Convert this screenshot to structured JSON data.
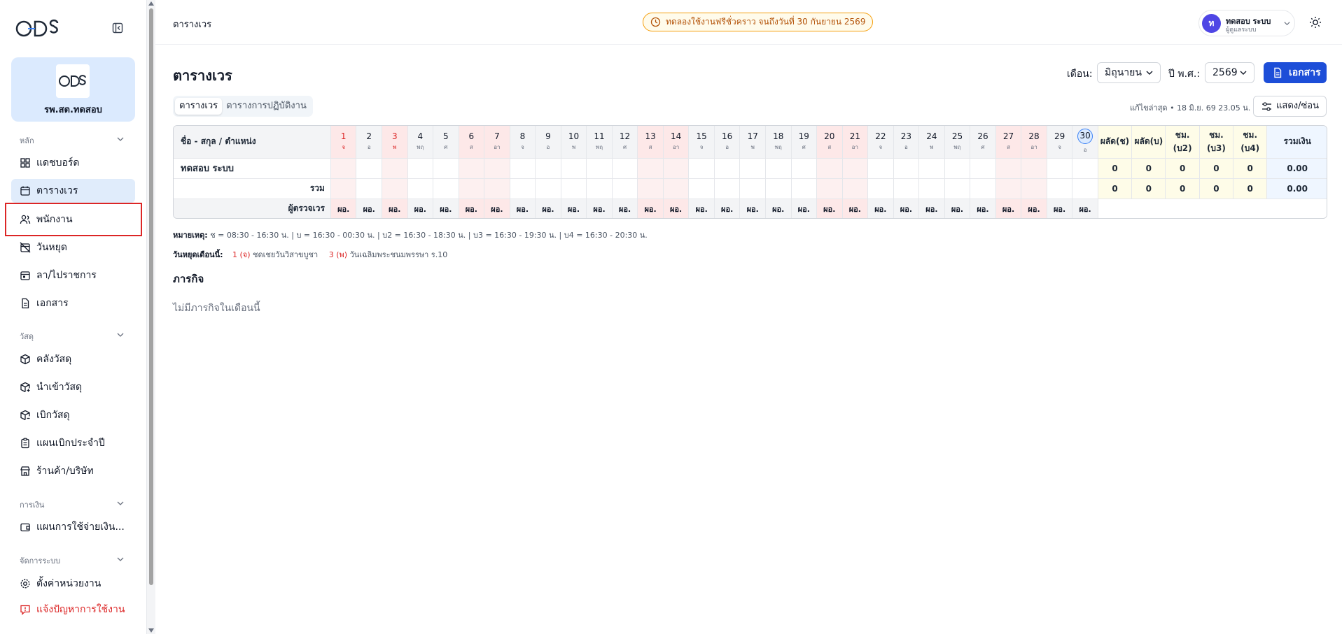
{
  "sidebar": {
    "org_name": "รพ.สต.ทดสอบ",
    "sections": [
      {
        "title": "หลัก"
      },
      {
        "title": "วัสดุ"
      },
      {
        "title": "การเงิน"
      },
      {
        "title": "จัดการระบบ"
      }
    ],
    "items": {
      "dashboard": "แดชบอร์ด",
      "schedule": "ตารางเวร",
      "staff": "พนักงาน",
      "holidays": "วันหยุด",
      "leave": "ลา/ไปราชการ",
      "documents": "เอกสาร",
      "stock": "คลังวัสดุ",
      "import": "นำเข้าวัสดุ",
      "withdraw": "เบิกวัสดุ",
      "yearly_plan": "แผนเบิกประจำปี",
      "vendors": "ร้านค้า/บริษัท",
      "budget_plan": "แผนการใช้จ่ายเงิน...",
      "unit_settings": "ตั้งค่าหน่วยงาน",
      "report_issue": "แจ้งปัญหาการใช้งาน"
    }
  },
  "topbar": {
    "breadcrumb": "ตารางเวร",
    "trial_notice": "ทดลองใช้งานฟรีชั่วคราว จนถึงวันที่ 30 กันยายน 2569",
    "user_initial": "ท",
    "user_name": "ทดสอบ ระบบ",
    "user_role": "ผู้ดูแลระบบ"
  },
  "main": {
    "title": "ตารางเวร",
    "month_label": "เดือน:",
    "month_value": "มิถุนายน",
    "year_label": "ปี พ.ศ.:",
    "year_value": "2569",
    "doc_button": "เอกสาร",
    "tabs": [
      "ตารางเวร",
      "ตารางการปฏิบัติงาน"
    ],
    "last_edit": "แก้ไขล่าสุด • 18 มิ.ย. 69 23.05 น.",
    "toggle_button": "แสดง/ซ่อน"
  },
  "table": {
    "name_header": "ชื่อ - สกุล / ตำแหน่ง",
    "days": [
      {
        "d": "1",
        "w": "จ",
        "red": true
      },
      {
        "d": "2",
        "w": "อ"
      },
      {
        "d": "3",
        "w": "พ",
        "red": true
      },
      {
        "d": "4",
        "w": "พฤ"
      },
      {
        "d": "5",
        "w": "ศ"
      },
      {
        "d": "6",
        "w": "ส",
        "wk": true
      },
      {
        "d": "7",
        "w": "อา",
        "wk": true
      },
      {
        "d": "8",
        "w": "จ"
      },
      {
        "d": "9",
        "w": "อ"
      },
      {
        "d": "10",
        "w": "พ"
      },
      {
        "d": "11",
        "w": "พฤ"
      },
      {
        "d": "12",
        "w": "ศ"
      },
      {
        "d": "13",
        "w": "ส",
        "wk": true
      },
      {
        "d": "14",
        "w": "อา",
        "wk": true
      },
      {
        "d": "15",
        "w": "จ"
      },
      {
        "d": "16",
        "w": "อ"
      },
      {
        "d": "17",
        "w": "พ"
      },
      {
        "d": "18",
        "w": "พฤ"
      },
      {
        "d": "19",
        "w": "ศ"
      },
      {
        "d": "20",
        "w": "ส",
        "wk": true
      },
      {
        "d": "21",
        "w": "อา",
        "wk": true
      },
      {
        "d": "22",
        "w": "จ"
      },
      {
        "d": "23",
        "w": "อ"
      },
      {
        "d": "24",
        "w": "พ"
      },
      {
        "d": "25",
        "w": "พฤ"
      },
      {
        "d": "26",
        "w": "ศ"
      },
      {
        "d": "27",
        "w": "ส",
        "wk": true
      },
      {
        "d": "28",
        "w": "อา",
        "wk": true
      },
      {
        "d": "29",
        "w": "จ"
      },
      {
        "d": "30",
        "w": "อ",
        "today": true
      }
    ],
    "summary_headers": [
      "ผลัด(ช)",
      "ผลัด(บ)",
      "ชม.(บ2)",
      "ชม.(บ3)",
      "ชม.(บ4)"
    ],
    "total_header": "รวมเงิน",
    "employee_name": "ทดสอบ ระบบ",
    "employee_values": [
      "0",
      "0",
      "0",
      "0",
      "0"
    ],
    "employee_total": "0.00",
    "sum_label": "รวม",
    "sum_values": [
      "0",
      "0",
      "0",
      "0",
      "0"
    ],
    "sum_total": "0.00",
    "inspector_label": "ผู้ตรวจเวร",
    "inspector_mark": "ผอ."
  },
  "legend": {
    "label": "หมายเหตุ:",
    "text": "ช = 08:30 - 16:30 น. | บ = 16:30 - 00:30 น. | บ2 = 16:30 - 18:30 น. | บ3 = 16:30 - 19:30 น. | บ4 = 16:30 - 20:30 น."
  },
  "holidays": {
    "label": "วันหยุดเดือนนี้:",
    "items": [
      {
        "day": "1 (จ)",
        "name": "ชดเชยวันวิสาขบูชา"
      },
      {
        "day": "3 (พ)",
        "name": "วันเฉลิมพระชนมพรรษา ร.10"
      }
    ]
  },
  "tasks": {
    "title": "ภารกิจ",
    "empty": "ไม่มีภารกิจในเดือนนี้"
  },
  "colors": {
    "primary": "#1d4ed8",
    "active_nav": "#e0ecfb",
    "warning": "#b45309",
    "danger": "#dc2626"
  }
}
